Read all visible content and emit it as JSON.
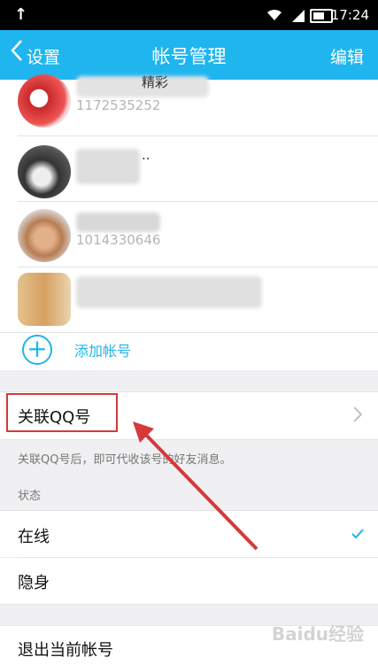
{
  "status_bar": {
    "time": "17:24"
  },
  "nav": {
    "back_label": "设置",
    "title": "帐号管理",
    "edit_label": "编辑"
  },
  "accounts": {
    "items": [
      {
        "id": "1172535252",
        "name_suffix": "精彩"
      },
      {
        "id": "",
        "name_suffix": ".."
      },
      {
        "id": "1014330646",
        "name_suffix": ""
      },
      {
        "id": "",
        "name_suffix": ""
      }
    ],
    "add_label": "添加帐号"
  },
  "link_qq": {
    "label": "关联QQ号",
    "hint": "关联QQ号后，即可代收该号的好友消息。"
  },
  "status_section": {
    "header": "状态",
    "options": [
      {
        "label": "在线",
        "selected": true
      },
      {
        "label": "隐身",
        "selected": false
      }
    ]
  },
  "logout_label": "退出当前帐号",
  "watermark": "Baidu经验",
  "colors": {
    "accent": "#1fb5ef",
    "annotation": "#d6393a"
  }
}
